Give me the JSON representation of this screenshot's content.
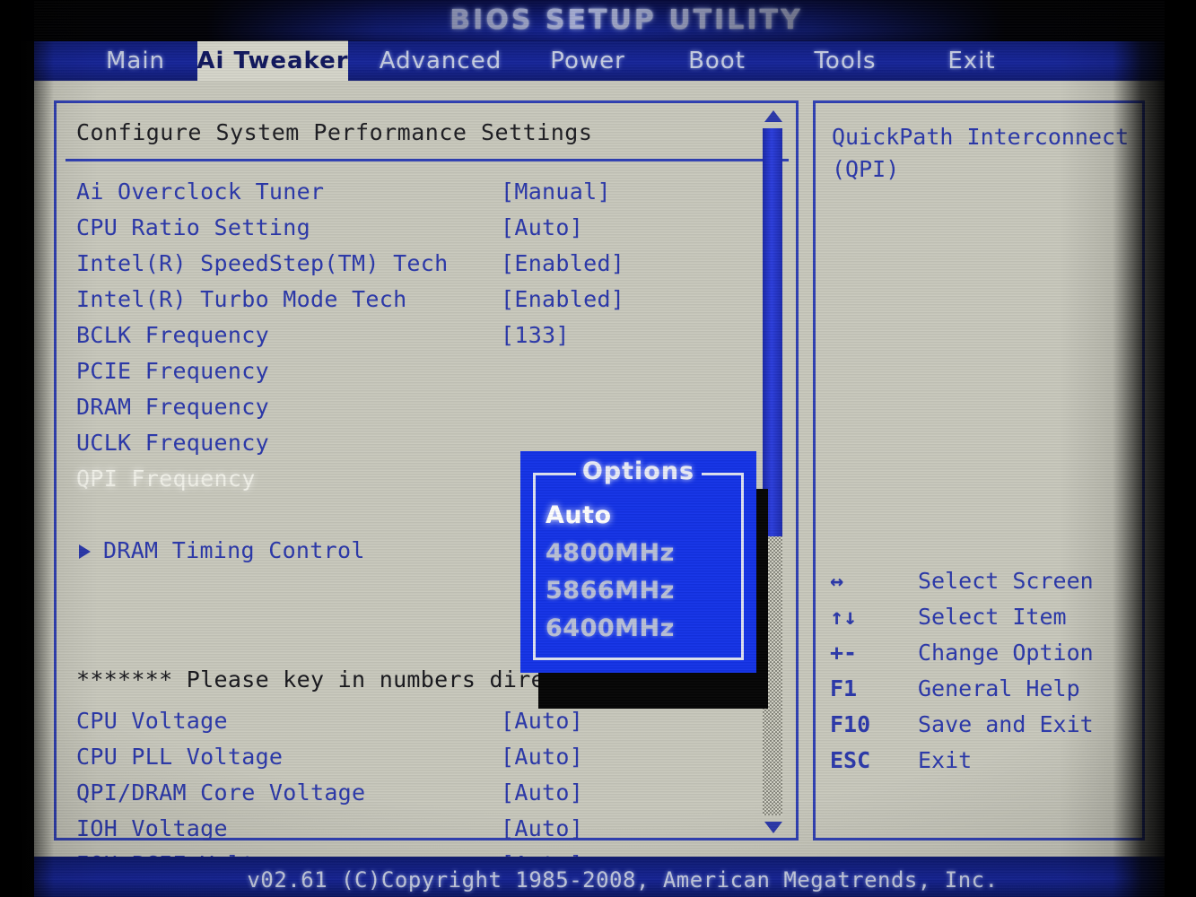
{
  "window": {
    "title": "BIOS SETUP UTILITY",
    "footer": "v02.61 (C)Copyright 1985-2008, American Megatrends, Inc."
  },
  "colors": {
    "screen_bg": "#c9c9bd",
    "accent_blue": "#2b38ab",
    "bar_blue": "#16259a",
    "popup_blue": "#1433e8",
    "selected_text": "#f2f2ea",
    "dark_text": "#1d1d22"
  },
  "menubar": {
    "items": [
      {
        "label": "Main",
        "active": false
      },
      {
        "label": "Ai Tweaker",
        "active": true
      },
      {
        "label": "Advanced",
        "active": false
      },
      {
        "label": "Power",
        "active": false
      },
      {
        "label": "Boot",
        "active": false
      },
      {
        "label": "Tools",
        "active": false
      },
      {
        "label": "Exit",
        "active": false
      }
    ]
  },
  "main": {
    "header": "Configure System Performance Settings",
    "settings": [
      {
        "label": "Ai Overclock Tuner",
        "value": "[Manual]"
      },
      {
        "label": "CPU Ratio Setting",
        "value": "[Auto]"
      },
      {
        "label": "Intel(R) SpeedStep(TM) Tech",
        "value": "[Enabled]"
      },
      {
        "label": "Intel(R) Turbo Mode Tech",
        "value": "[Enabled]"
      },
      {
        "label": "BCLK Frequency",
        "value": "[133]"
      },
      {
        "label": "PCIE Frequency",
        "value": ""
      },
      {
        "label": "DRAM Frequency",
        "value": ""
      },
      {
        "label": "UCLK Frequency",
        "value": ""
      },
      {
        "label": "QPI Frequency",
        "value": ""
      }
    ],
    "submenu": {
      "label": "DRAM Timing Control"
    },
    "note": "******* Please key in numbers directly! *******",
    "voltages": [
      {
        "label": "CPU Voltage",
        "value": "[Auto]"
      },
      {
        "label": "CPU PLL Voltage",
        "value": "[Auto]"
      },
      {
        "label": "QPI/DRAM Core Voltage",
        "value": "[Auto]"
      },
      {
        "label": "IOH Voltage",
        "value": "[Auto]"
      },
      {
        "label": "IOH PCIE Voltage",
        "value": "[Auto]"
      }
    ]
  },
  "popup": {
    "title": "Options",
    "options": [
      {
        "label": "Auto",
        "selected": true
      },
      {
        "label": "4800MHz",
        "selected": false
      },
      {
        "label": "5866MHz",
        "selected": false
      },
      {
        "label": "6400MHz",
        "selected": false
      }
    ]
  },
  "help": {
    "description": "QuickPath Interconnect (QPI)",
    "legend": [
      {
        "key": "↔",
        "desc": "Select Screen"
      },
      {
        "key": "↑↓",
        "desc": "Select Item"
      },
      {
        "key": "+-",
        "desc": "Change Option"
      },
      {
        "key": "F1",
        "desc": "General Help"
      },
      {
        "key": "F10",
        "desc": "Save and Exit"
      },
      {
        "key": "ESC",
        "desc": "Exit"
      }
    ]
  },
  "scrollbar": {
    "up_icon": "triangle-up-icon",
    "down_icon": "triangle-down-icon"
  }
}
